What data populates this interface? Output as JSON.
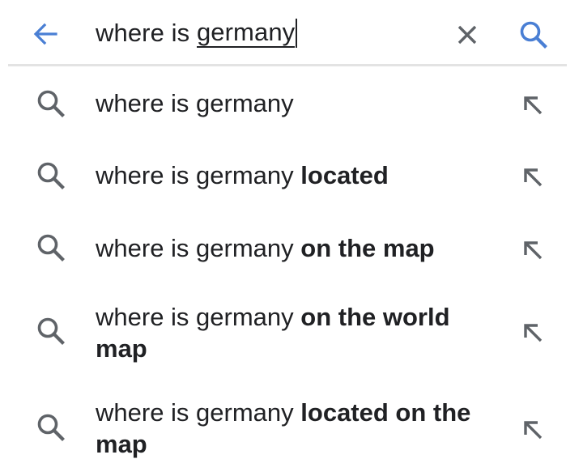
{
  "search_bar": {
    "query_prefix": "where is ",
    "query_composing": "germany",
    "icons": {
      "back": "arrow-left-icon",
      "clear": "close-icon",
      "search": "search-icon"
    },
    "colors": {
      "accent": "#4a7fd4",
      "icon_gray": "#5f6368"
    }
  },
  "suggestions": [
    {
      "base": "where is germany",
      "bold": ""
    },
    {
      "base": "where is germany ",
      "bold": "located"
    },
    {
      "base": "where is germany ",
      "bold": "on the map"
    },
    {
      "base": "where is germany ",
      "bold": "on the world map"
    },
    {
      "base": "where is germany ",
      "bold": "located on the map"
    }
  ]
}
